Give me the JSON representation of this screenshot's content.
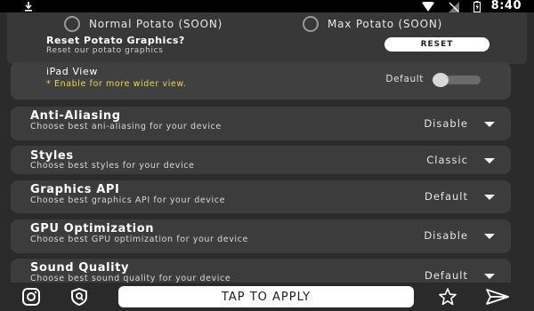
{
  "status_bar": {
    "time": "8:40",
    "icons": [
      "download-icon",
      "wifi-icon",
      "no-signal-icon",
      "battery-icon"
    ]
  },
  "potato": {
    "options": [
      {
        "label": "Normal Potato (SOON)",
        "selected": false
      },
      {
        "label": "Max Potato (SOON)",
        "selected": false
      }
    ],
    "reset_title": "Reset Potato  Graphics?",
    "reset_desc": "Reset our potato graphics",
    "reset_button": "RESET"
  },
  "ipad_view": {
    "title": "iPad View",
    "desc": "* Enable for more wider view.",
    "state_label": "Default",
    "enabled": false
  },
  "settings": [
    {
      "title": "Anti-Aliasing",
      "desc": "Choose best ani-aliasing for your device",
      "value": "Disable"
    },
    {
      "title": "Styles",
      "desc": "Choose best styles for your device",
      "value": "Classic"
    },
    {
      "title": "Graphics API",
      "desc": "Choose best graphics API for your device",
      "value": "Default"
    },
    {
      "title": "GPU Optimization",
      "desc": "Choose best GPU optimization for your device",
      "value": "Disable"
    },
    {
      "title": "Sound Quality",
      "desc": "Choose best sound quality for your device",
      "value": "Default"
    }
  ],
  "bottom_bar": {
    "apply_label": "TAP TO APPLY",
    "icons": [
      "instagram-icon",
      "shield-icon",
      "star-icon",
      "send-icon"
    ]
  },
  "colors": {
    "background": "#2b2b2b",
    "card": "#3c3c3c",
    "accent_yellow": "#f2d44a"
  }
}
